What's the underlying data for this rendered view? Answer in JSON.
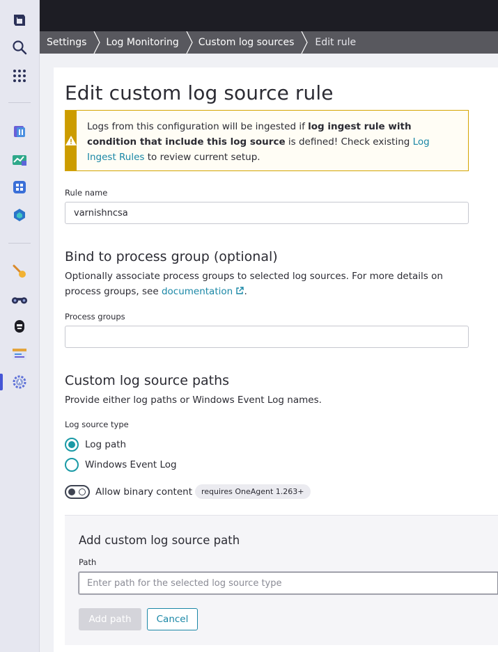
{
  "nav": {
    "icons": [
      "logo-icon",
      "search-icon",
      "apps-grid-icon",
      "dashboards-icon",
      "infrastructure-icon",
      "apps-icon",
      "services-icon",
      "key-icon",
      "binoculars-icon",
      "agent-icon",
      "logs-icon",
      "settings-gear-icon"
    ]
  },
  "breadcrumb": {
    "items": [
      "Settings",
      "Log Monitoring",
      "Custom log sources",
      "Edit rule"
    ]
  },
  "page": {
    "title": "Edit custom log source rule"
  },
  "warning": {
    "text_1": "Logs from this configuration will be ingested if ",
    "bold": "log ingest rule with condition that include this log source",
    "text_2": " is defined! Check existing ",
    "link": "Log Ingest Rules",
    "text_3": " to review current setup."
  },
  "rule_name": {
    "label": "Rule name",
    "value": "varnishncsa"
  },
  "process_group": {
    "heading": "Bind to process group (optional)",
    "desc_1": "Optionally associate process groups to selected log sources. For more details on process groups, see ",
    "link": "documentation",
    "desc_2": ".",
    "label": "Process groups",
    "value": ""
  },
  "paths": {
    "heading": "Custom log source paths",
    "desc": "Provide either log paths or Windows Event Log names.",
    "type_label": "Log source type",
    "options": [
      "Log path",
      "Windows Event Log"
    ],
    "selected": "Log path",
    "binary_label": "Allow binary content",
    "binary_enabled": false,
    "binary_pill": "requires OneAgent 1.263+"
  },
  "add_path": {
    "heading": "Add custom log source path",
    "path_label": "Path",
    "placeholder": "Enter path for the selected log source type",
    "add_button": "Add path",
    "cancel_button": "Cancel"
  },
  "colors": {
    "accent": "#1a87a6",
    "warning": "#cc9c00",
    "topbar": "#1d1d24",
    "breadcrumb": "#58585e"
  }
}
